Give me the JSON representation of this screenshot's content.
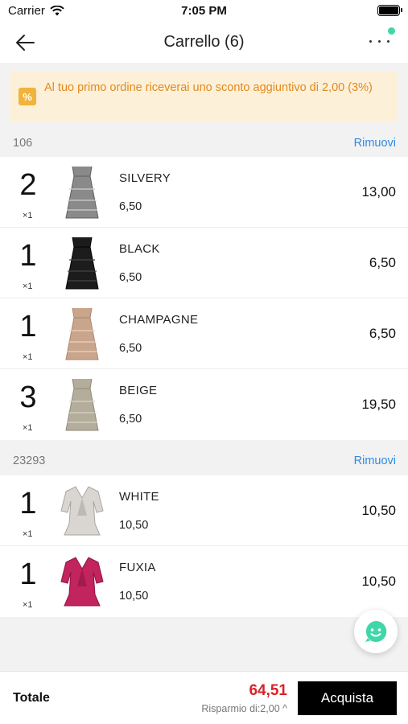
{
  "status_bar": {
    "carrier": "Carrier",
    "time": "7:05 PM"
  },
  "nav": {
    "title": "Carrello (6)"
  },
  "promo": {
    "text": "Al tuo primo ordine riceverai uno sconto aggiuntivo di 2,00 (3%)",
    "icon": "percent-icon"
  },
  "groups": [
    {
      "id": "106",
      "remove_label": "Rimuovi",
      "items": [
        {
          "qty": "2",
          "mult": "×1",
          "name": "SILVERY",
          "unit_price": "6,50",
          "total": "13,00",
          "color": "#8a8a8a"
        },
        {
          "qty": "1",
          "mult": "×1",
          "name": "BLACK",
          "unit_price": "6,50",
          "total": "6,50",
          "color": "#1c1c1c"
        },
        {
          "qty": "1",
          "mult": "×1",
          "name": "CHAMPAGNE",
          "unit_price": "6,50",
          "total": "6,50",
          "color": "#c9a58c"
        },
        {
          "qty": "3",
          "mult": "×1",
          "name": "BEIGE",
          "unit_price": "6,50",
          "total": "19,50",
          "color": "#b5ad9c"
        }
      ]
    },
    {
      "id": "23293",
      "remove_label": "Rimuovi",
      "items": [
        {
          "qty": "1",
          "mult": "×1",
          "name": "WHITE",
          "unit_price": "10,50",
          "total": "10,50",
          "color": "#d9d6d2"
        },
        {
          "qty": "1",
          "mult": "×1",
          "name": "FUXIA",
          "unit_price": "10,50",
          "total": "10,50",
          "color": "#c2245e"
        }
      ]
    }
  ],
  "footer": {
    "total_label": "Totale",
    "total_amount": "64,51",
    "savings": "Risparmio di:2,00",
    "buy_label": "Acquista"
  },
  "colors": {
    "accent_red": "#d8232a",
    "link_blue": "#2f8ae0",
    "promo_text": "#e08a1f",
    "chat_green": "#3fd7a8"
  }
}
